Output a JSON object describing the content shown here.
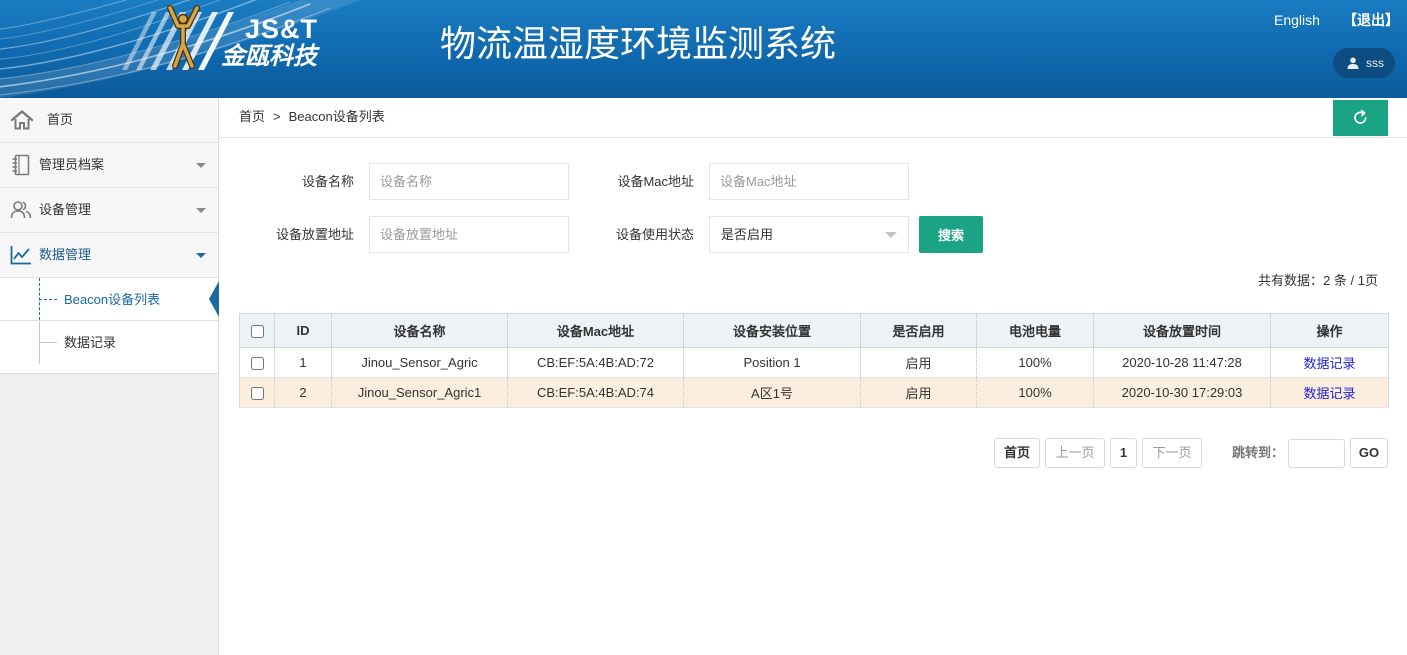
{
  "header": {
    "logo_en": "JS&T",
    "logo_cn": "金瓯科技",
    "title": "物流温湿度环境监测系统",
    "lang_link": "English",
    "logout": "【退出】",
    "user_name": "sss",
    "user_icon": "user-icon"
  },
  "sidebar": {
    "items": [
      {
        "label": "首页",
        "icon": "home-icon"
      },
      {
        "label": "管理员档案",
        "icon": "notebook-icon",
        "chevron": "chevron-down-icon"
      },
      {
        "label": "设备管理",
        "icon": "users-icon",
        "chevron": "chevron-down-icon"
      },
      {
        "label": "数据管理",
        "icon": "line-chart-icon",
        "chevron": "chevron-down-icon",
        "expanded": true,
        "children": [
          {
            "label": "Beacon设备列表",
            "active": true
          },
          {
            "label": "数据记录",
            "active": false
          }
        ]
      }
    ]
  },
  "breadcrumb": {
    "home": "首页",
    "separator": ">",
    "current": "Beacon设备列表"
  },
  "refresh_button": {
    "icon": "refresh-icon"
  },
  "search_form": {
    "device_name": {
      "label": "设备名称",
      "value": "",
      "placeholder": "设备名称"
    },
    "device_mac": {
      "label": "设备Mac地址",
      "value": "",
      "placeholder": "设备Mac地址"
    },
    "device_address": {
      "label": "设备放置地址",
      "value": "",
      "placeholder": "设备放置地址"
    },
    "device_status": {
      "label": "设备使用状态",
      "selected": "是否启用"
    },
    "search_label": "搜索"
  },
  "summary": {
    "prefix": "共有数据：",
    "total": "2",
    "middle": " 条 / ",
    "pages": "1",
    "suffix": "页"
  },
  "table": {
    "columns": [
      "ID",
      "设备名称",
      "设备Mac地址",
      "设备安装位置",
      "是否启用",
      "电池电量",
      "设备放置时间",
      "操作"
    ],
    "rows": [
      {
        "id": "1",
        "name": "Jinou_Sensor_Agric",
        "mac": "CB:EF:5A:4B:AD:72",
        "location": "Position 1",
        "enabled": "启用",
        "battery": "100%",
        "placed_at": "2020-10-28 11:47:28",
        "action": "数据记录",
        "highlighted": false
      },
      {
        "id": "2",
        "name": "Jinou_Sensor_Agric1",
        "mac": "CB:EF:5A:4B:AD:74",
        "location": "A区1号",
        "enabled": "启用",
        "battery": "100%",
        "placed_at": "2020-10-30 17:29:03",
        "action": "数据记录",
        "highlighted": true
      }
    ]
  },
  "pagination": {
    "first": "首页",
    "prev": "上一页",
    "current": "1",
    "next": "下一页",
    "jump_label": "跳转到：",
    "jump_value": "",
    "go": "GO"
  },
  "colors": {
    "header_blue": "#1070b5",
    "accent": "#1ba386",
    "active_blue": "#1a6aa3",
    "link": "#2323d1",
    "row_highlight": "#fbeedf",
    "table_header_bg": "#edf2f5"
  }
}
